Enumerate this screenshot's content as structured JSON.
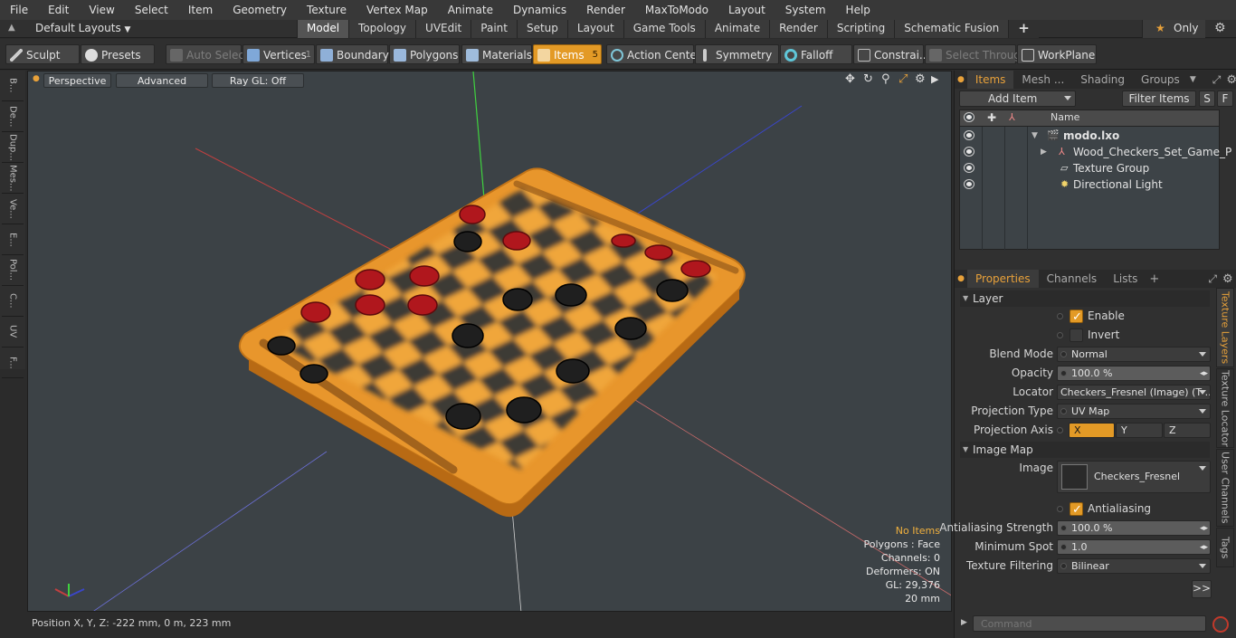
{
  "menu": [
    "File",
    "Edit",
    "View",
    "Select",
    "Item",
    "Geometry",
    "Texture",
    "Vertex Map",
    "Animate",
    "Dynamics",
    "Render",
    "MaxToModo",
    "Layout",
    "System",
    "Help"
  ],
  "layout_selector": "Default Layouts",
  "tabs": [
    "Model",
    "Topology",
    "UVEdit",
    "Paint",
    "Setup",
    "Layout",
    "Game Tools",
    "Animate",
    "Render",
    "Scripting",
    "Schematic Fusion"
  ],
  "only_label": "Only",
  "toolbar": {
    "sculpt": "Sculpt",
    "presets": "Presets",
    "auto_select": "Auto Select",
    "vertices": "Vertices",
    "vertices_count": "1",
    "boundary": "Boundary",
    "polygons": "Polygons",
    "materials": "Materials",
    "items": "Items",
    "items_count": "5",
    "action_center": "Action Center",
    "symmetry": "Symmetry",
    "falloff": "Falloff",
    "constraints": "Constrai...",
    "select_through": "Select Through",
    "workplane": "WorkPlane"
  },
  "left_tools": [
    "B...",
    "De...",
    "Dup...",
    "Mes...",
    "Ve...",
    "E...",
    "Pol...",
    "C...",
    "UV",
    "F..."
  ],
  "viewport": {
    "perspective": "Perspective",
    "advanced": "Advanced",
    "raygl": "Ray GL: Off",
    "hud": {
      "no_items": "No Items",
      "polygons": "Polygons : Face",
      "channels": "Channels: 0",
      "deformers": "Deformers: ON",
      "gl": "GL: 29,376",
      "scale": "20 mm"
    }
  },
  "status_position": "Position X, Y, Z:  -222 mm, 0 m, 223 mm",
  "items_panel": {
    "tabs": [
      "Items",
      "Mesh ...",
      "Shading",
      "Groups"
    ],
    "add_item": "Add Item",
    "filter_items": "Filter Items",
    "s": "S",
    "f": "F",
    "name_header": "Name",
    "rows": [
      "modo.lxo",
      "Wood_Checkers_Set_Game_P ...",
      "Texture Group",
      "Directional Light"
    ]
  },
  "properties_panel": {
    "tabs": [
      "Properties",
      "Channels",
      "Lists"
    ],
    "layer_section": "Layer",
    "enable": "Enable",
    "invert": "Invert",
    "blend_mode_label": "Blend Mode",
    "blend_mode": "Normal",
    "opacity_label": "Opacity",
    "opacity": "100.0 %",
    "locator_label": "Locator",
    "locator": "Checkers_Fresnel (Image) (T ...",
    "projection_type_label": "Projection Type",
    "projection_type": "UV Map",
    "projection_axis_label": "Projection Axis",
    "axis_x": "X",
    "axis_y": "Y",
    "axis_z": "Z",
    "image_map_section": "Image Map",
    "image_label": "Image",
    "image": "Checkers_Fresnel",
    "antialiasing": "Antialiasing",
    "aa_strength_label": "Antialiasing Strength",
    "aa_strength": "100.0 %",
    "min_spot_label": "Minimum Spot",
    "min_spot": "1.0",
    "tex_filter_label": "Texture Filtering",
    "tex_filter": "Bilinear",
    "more": ">>",
    "side_tabs": [
      "Texture Layers",
      "Texture Locator",
      "User Channels",
      "Tags"
    ]
  },
  "command_placeholder": "Command",
  "colors": {
    "accent": "#e39a26",
    "board": "#e8962c"
  }
}
